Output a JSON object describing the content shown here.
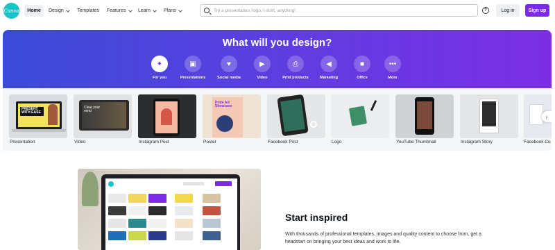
{
  "nav": {
    "logo_text": "Canva",
    "items": [
      {
        "label": "Home"
      },
      {
        "label": "Design"
      },
      {
        "label": "Templates"
      },
      {
        "label": "Features"
      },
      {
        "label": "Learn"
      },
      {
        "label": "Plans"
      }
    ],
    "search_placeholder": "Try a presentation, logo, t-shirt, anything!",
    "help_glyph": "?",
    "login_label": "Log in",
    "signup_label": "Sign up",
    "accent_color": "#7d2ae8"
  },
  "hero": {
    "title": "What will you design?",
    "categories": [
      {
        "label": "For you",
        "icon": "sparkle-icon",
        "active": true
      },
      {
        "label": "Presentations",
        "icon": "presentation-icon"
      },
      {
        "label": "Social media",
        "icon": "heart-chat-icon"
      },
      {
        "label": "Video",
        "icon": "video-camera-icon"
      },
      {
        "label": "Print products",
        "icon": "printer-icon"
      },
      {
        "label": "Marketing",
        "icon": "megaphone-icon"
      },
      {
        "label": "Office",
        "icon": "briefcase-icon"
      },
      {
        "label": "More",
        "icon": "more-dots-icon"
      }
    ]
  },
  "designs": [
    {
      "label": "Presentation",
      "thumb_text": "PRESENT WITH EASE"
    },
    {
      "label": "Video",
      "thumb_text": "Clear your mind"
    },
    {
      "label": "Instagram Post"
    },
    {
      "label": "Poster",
      "thumb_text": "Pride Art Showcase"
    },
    {
      "label": "Facebook Post"
    },
    {
      "label": "Logo"
    },
    {
      "label": "YouTube Thumbnail"
    },
    {
      "label": "Instagram Story"
    },
    {
      "label": "Facebook Co"
    }
  ],
  "feature": {
    "title": "Start inspired",
    "text": "With thousands of professional templates, images and quality content to choose from, get a headstart on bringing your best ideas and work to life."
  }
}
